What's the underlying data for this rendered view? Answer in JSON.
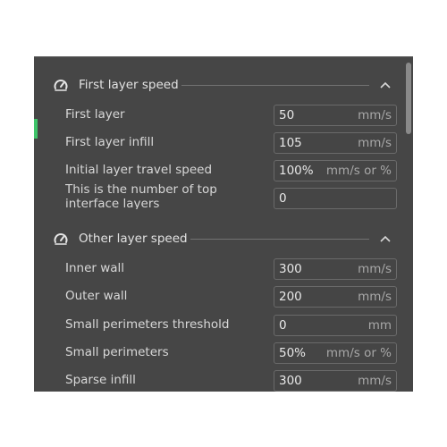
{
  "sections": [
    {
      "title": "First layer speed",
      "icon": "speedometer-icon",
      "collapse_icon": "chevron-up-icon",
      "rows": [
        {
          "label": "First layer",
          "value": "50",
          "unit": "mm/s"
        },
        {
          "label": "First layer infill",
          "value": "105",
          "unit": "mm/s"
        },
        {
          "label": "Initial layer travel speed",
          "value": "100%",
          "unit": "mm/s or %"
        },
        {
          "label": "This is the number of top interface layers",
          "value": "0",
          "unit": ""
        }
      ]
    },
    {
      "title": "Other layer speed",
      "icon": "speedometer-icon",
      "collapse_icon": "chevron-up-icon",
      "rows": [
        {
          "label": "Inner wall",
          "value": "300",
          "unit": "mm/s"
        },
        {
          "label": "Outer wall",
          "value": "200",
          "unit": "mm/s"
        },
        {
          "label": "Small perimeters threshold",
          "value": "0",
          "unit": "mm"
        },
        {
          "label": "Small perimeters",
          "value": "50%",
          "unit": "mm/s or %"
        },
        {
          "label": "Sparse infill",
          "value": "300",
          "unit": "mm/s"
        }
      ]
    }
  ],
  "colors": {
    "panel_bg": "#464646",
    "accent": "#3fc46a",
    "text": "#d8d8d8",
    "unit_text": "#a8a8a8"
  }
}
